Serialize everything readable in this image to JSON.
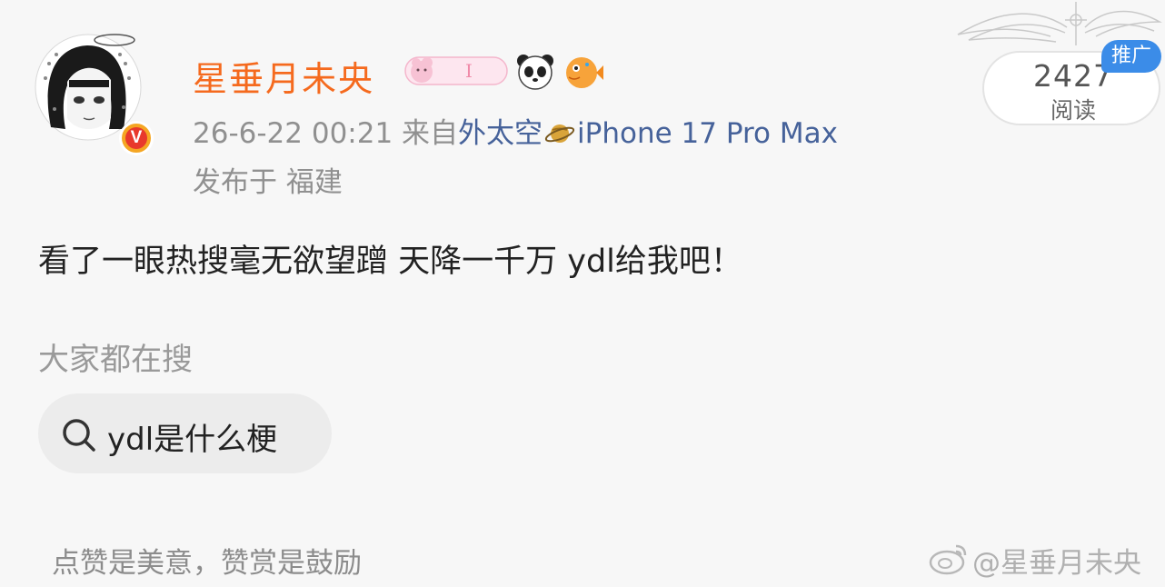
{
  "user": {
    "name": "星垂月未央",
    "verified_badge_letter": "V",
    "avatar_icon": "anime-girl-avatar",
    "badge_icons": [
      "pink-bear-badge",
      "panda-icon",
      "pufferfish-icon"
    ]
  },
  "meta": {
    "timestamp": "26-6-22 00:21",
    "source_prefix": "来自",
    "source_name": "外太空",
    "source_icon": "saturn-planet-icon",
    "device": "iPhone 17 Pro Max",
    "location": "发布于 福建"
  },
  "stats": {
    "read_count": "2427",
    "read_label": "阅读",
    "promo_tag": "推广"
  },
  "post": {
    "text": "看了一眼热搜毫无欲望蹭 天降一千万 ydl给我吧！"
  },
  "search_section": {
    "title": "大家都在搜",
    "chip_label": "ydl是什么梗",
    "chip_icon": "search-icon"
  },
  "footer": {
    "left_text": "点赞是美意，赞赏是鼓励",
    "watermark": "@星垂月未央",
    "watermark_icon": "weibo-logo-icon"
  },
  "colors": {
    "username": "#f56a1e",
    "link": "#46629a",
    "promo": "#3b8ce8",
    "background": "#f7f7f7"
  }
}
